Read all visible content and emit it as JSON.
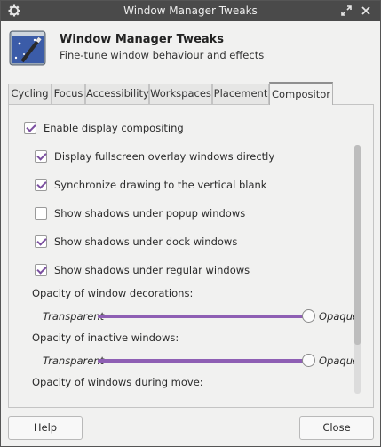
{
  "window": {
    "title": "Window Manager Tweaks"
  },
  "header": {
    "title": "Window Manager Tweaks",
    "subtitle": "Fine-tune window behaviour and effects"
  },
  "tabs": [
    {
      "label": "Cycling",
      "active": false
    },
    {
      "label": "Focus",
      "active": false
    },
    {
      "label": "Accessibility",
      "active": false
    },
    {
      "label": "Workspaces",
      "active": false
    },
    {
      "label": "Placement",
      "active": false
    },
    {
      "label": "Compositor",
      "active": true
    }
  ],
  "compositor": {
    "enable": {
      "label": "Enable display compositing",
      "checked": true
    },
    "options": [
      {
        "label": "Display fullscreen overlay windows directly",
        "checked": true
      },
      {
        "label": "Synchronize drawing to the vertical blank",
        "checked": true
      },
      {
        "label": "Show shadows under popup windows",
        "checked": false
      },
      {
        "label": "Show shadows under dock windows",
        "checked": true
      },
      {
        "label": "Show shadows under regular windows",
        "checked": true
      }
    ],
    "sliders": [
      {
        "label": "Opacity of window decorations:",
        "min_label": "Transparent",
        "max_label": "Opaque",
        "value": 1.0
      },
      {
        "label": "Opacity of inactive windows:",
        "min_label": "Transparent",
        "max_label": "Opaque",
        "value": 1.0
      }
    ],
    "move_label": "Opacity of windows during move:"
  },
  "buttons": {
    "help": "Help",
    "close": "Close"
  },
  "colors": {
    "accent": "#8e5fb4",
    "titlebar": "#4a4a4a"
  },
  "icons": {
    "window_menu": "gear-icon",
    "maximize": "maximize-icon",
    "close": "close-icon",
    "app": "window-manager-tweaks-icon"
  }
}
